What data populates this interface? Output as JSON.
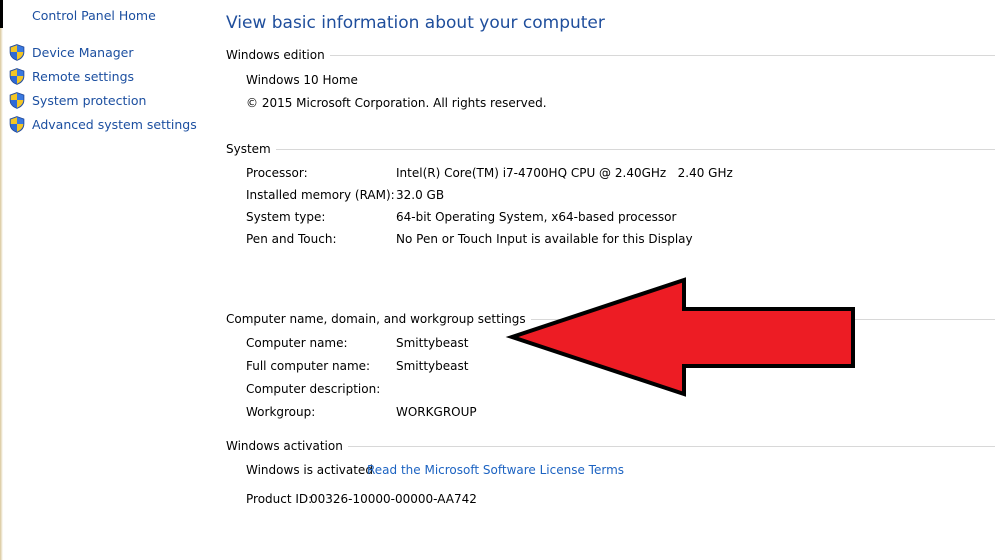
{
  "sidebar": {
    "home": "Control Panel Home",
    "items": [
      {
        "label": "Device Manager",
        "icon": "uac-shield-icon"
      },
      {
        "label": "Remote settings",
        "icon": "uac-shield-icon"
      },
      {
        "label": "System protection",
        "icon": "uac-shield-icon"
      },
      {
        "label": "Advanced system settings",
        "icon": "uac-shield-icon"
      }
    ]
  },
  "main": {
    "title": "View basic information about your computer",
    "edition": {
      "header": "Windows edition",
      "name": "Windows 10 Home",
      "copyright": "© 2015 Microsoft Corporation. All rights reserved."
    },
    "system": {
      "header": "System",
      "rows": [
        {
          "key": "Processor:",
          "value": "Intel(R) Core(TM) i7-4700HQ CPU @ 2.40GHz   2.40 GHz"
        },
        {
          "key": "Installed memory (RAM):",
          "value": "32.0 GB"
        },
        {
          "key": "System type:",
          "value": "64-bit Operating System, x64-based processor"
        },
        {
          "key": "Pen and Touch:",
          "value": "No Pen or Touch Input is available for this Display"
        }
      ]
    },
    "computer": {
      "header": "Computer name, domain, and workgroup settings",
      "rows": [
        {
          "key": "Computer name:",
          "value": "Smittybeast"
        },
        {
          "key": "Full computer name:",
          "value": "Smittybeast"
        },
        {
          "key": "Computer description:",
          "value": ""
        },
        {
          "key": "Workgroup:",
          "value": "WORKGROUP"
        }
      ]
    },
    "activation": {
      "header": "Windows activation",
      "status": "Windows is activated",
      "license_link": "Read the Microsoft Software License Terms",
      "product_id_label": "Product ID:",
      "product_id": "00326-10000-00000-AA742"
    }
  },
  "annotation": {
    "arrow_color": "#ed1c24",
    "outline_color": "#000000",
    "icon": "red-arrow-annotation"
  },
  "colors": {
    "link": "#1c63c2",
    "title": "#1f4e9c",
    "sidebar_link": "#1c4fa0"
  }
}
